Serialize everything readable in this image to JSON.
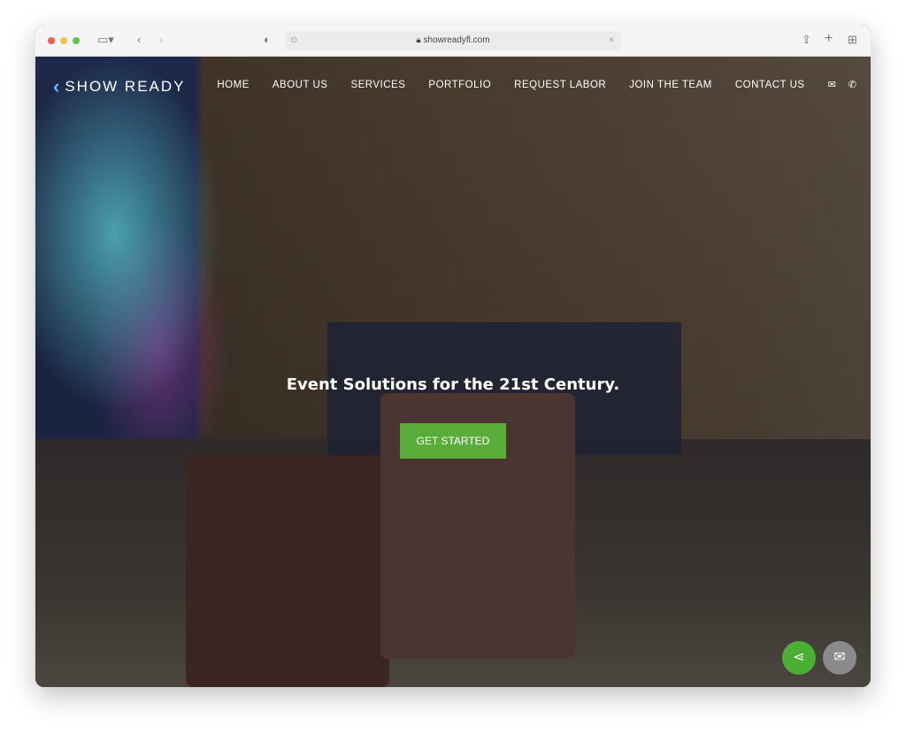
{
  "browser": {
    "url": "showreadyfl.com",
    "traffic_colors": [
      "#ec5f56",
      "#f4bd4f",
      "#60c453"
    ]
  },
  "brand": {
    "name": "SHOW READY",
    "accent": "#6fb6ff"
  },
  "nav": {
    "items": [
      "HOME",
      "ABOUT US",
      "SERVICES",
      "PORTFOLIO",
      "REQUEST LABOR",
      "JOIN THE TEAM",
      "CONTACT US"
    ],
    "icons": [
      "envelope-icon",
      "phone-icon"
    ]
  },
  "hero": {
    "tagline": "Event Solutions for the 21st Century.",
    "cta": "GET STARTED",
    "cta_color": "#5aad3a"
  },
  "floating": {
    "share_color": "#4caf33",
    "mail_color": "#8a8a8a"
  }
}
